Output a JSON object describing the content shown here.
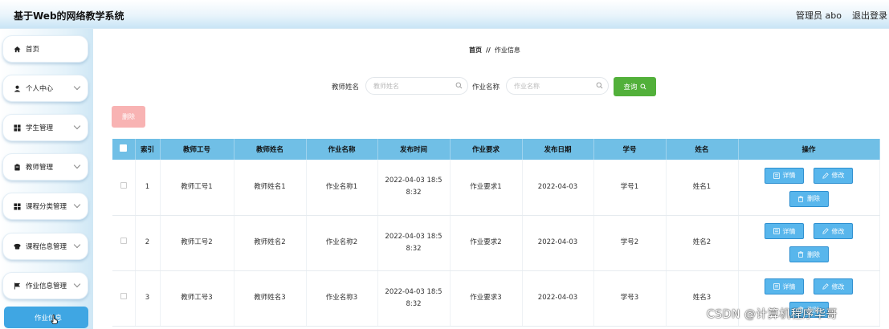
{
  "header": {
    "app_title": "基于Web的网络教学系统",
    "user_label": "管理员 abo",
    "logout_label": "退出登录"
  },
  "sidebar": {
    "items": [
      {
        "label": "首页",
        "icon": "home-icon",
        "has_chevron": false
      },
      {
        "label": "个人中心",
        "icon": "user-icon",
        "has_chevron": true
      },
      {
        "label": "学生管理",
        "icon": "grid-icon",
        "has_chevron": true
      },
      {
        "label": "教师管理",
        "icon": "clipboard-icon",
        "has_chevron": true
      },
      {
        "label": "课程分类管理",
        "icon": "grid-icon",
        "has_chevron": true
      },
      {
        "label": "课程信息管理",
        "icon": "hat-icon",
        "has_chevron": true
      },
      {
        "label": "作业信息管理",
        "icon": "flag-icon",
        "has_chevron": true
      }
    ],
    "active_sub_item": "作业信息"
  },
  "breadcrumb": {
    "home": "首页",
    "separator": "//",
    "current": "作业信息"
  },
  "search": {
    "teacher_name_label": "教师姓名",
    "teacher_name_placeholder": "教师姓名",
    "homework_name_label": "作业名称",
    "homework_name_placeholder": "作业名称",
    "query_button": "查询"
  },
  "delete_button": "删除",
  "table": {
    "headers": [
      "索引",
      "教师工号",
      "教师姓名",
      "作业名称",
      "发布时间",
      "作业要求",
      "发布日期",
      "学号",
      "姓名",
      "操作"
    ],
    "rows": [
      {
        "index": "1",
        "teacher_id": "教师工号1",
        "teacher_name": "教师姓名1",
        "homework_name": "作业名称1",
        "publish_time": "2022-04-03 18:58:32",
        "requirement": "作业要求1",
        "publish_date": "2022-04-03",
        "student_id": "学号1",
        "name": "姓名1"
      },
      {
        "index": "2",
        "teacher_id": "教师工号2",
        "teacher_name": "教师姓名2",
        "homework_name": "作业名称2",
        "publish_time": "2022-04-03 18:58:32",
        "requirement": "作业要求2",
        "publish_date": "2022-04-03",
        "student_id": "学号2",
        "name": "姓名2"
      },
      {
        "index": "3",
        "teacher_id": "教师工号3",
        "teacher_name": "教师姓名3",
        "homework_name": "作业名称3",
        "publish_time": "2022-04-03 18:58:32",
        "requirement": "作业要求3",
        "publish_date": "2022-04-03",
        "student_id": "学号3",
        "name": "姓名3"
      }
    ],
    "actions": {
      "detail": "详情",
      "edit": "修改",
      "delete": "删除"
    }
  },
  "watermark": "CSDN @计算机程序华哥",
  "colors": {
    "header_gradient_end": "#c9e5f6",
    "table_header": "#70bfe6",
    "query_button": "#52b03a",
    "delete_button": "#f8b3b3",
    "action_button": "#58b6ec",
    "active_sub_item": "#3fa6e3"
  }
}
